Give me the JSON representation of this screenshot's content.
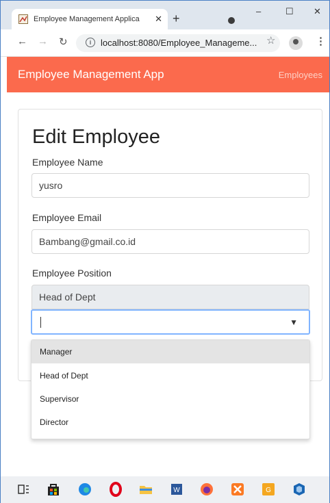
{
  "browser": {
    "tab_title": "Employee Management Applica",
    "tab_close": "✕",
    "new_tab": "+",
    "url": "localhost:8080/Employee_Manageme...",
    "min": "–",
    "max": "☐",
    "close": "✕"
  },
  "navbar": {
    "brand": "Employee Management App",
    "link": "Employees"
  },
  "form": {
    "title": "Edit Employee",
    "name_label": "Employee Name",
    "name_value": "yusro",
    "email_label": "Employee Email",
    "email_value": "Bambang@gmail.co.id",
    "position_label": "Employee Position",
    "position_value": "Head of Dept"
  },
  "dropdown": {
    "search_value": "",
    "options": [
      "Manager",
      "Head of Dept",
      "Supervisor",
      "Director"
    ],
    "highlighted": "Manager"
  },
  "taskbar": {
    "icons": [
      "task-view-icon",
      "store-icon",
      "edge-icon",
      "opera-icon",
      "file-explorer-icon",
      "word-icon",
      "firefox-icon",
      "xampp-icon",
      "app-icon",
      "virtualbox-icon"
    ]
  },
  "colors": {
    "navbar": "#fb6a4d",
    "focus_border": "#80b4ff"
  }
}
